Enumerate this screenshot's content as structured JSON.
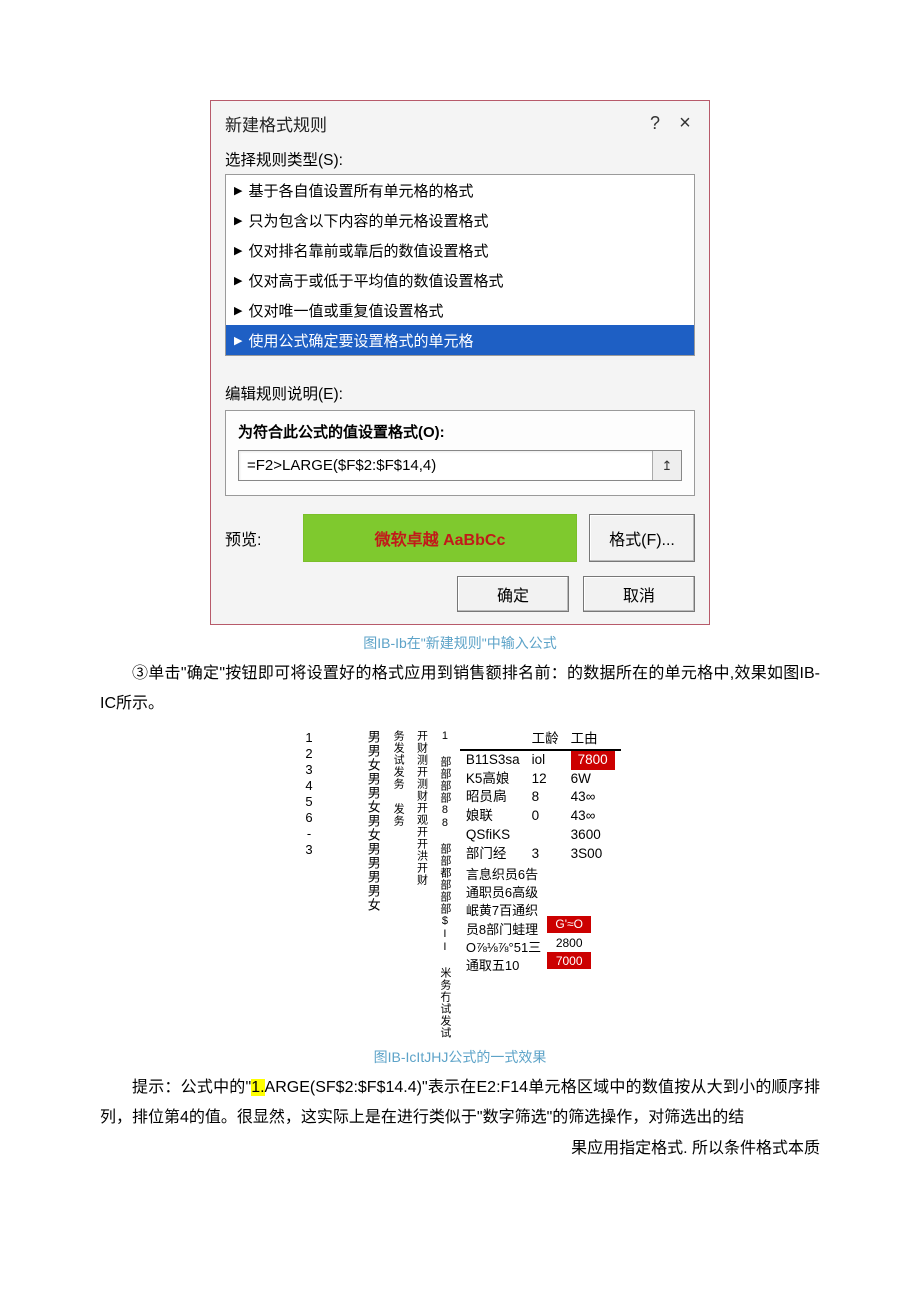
{
  "dialog": {
    "title": "新建格式规则",
    "help": "?",
    "close": "×",
    "section_select": "选择规则类型(S):",
    "rules": [
      "基于各自值设置所有单元格的格式",
      "只为包含以下内容的单元格设置格式",
      "仅对排名靠前或靠后的数值设置格式",
      "仅对高于或低于平均值的数值设置格式",
      "仅对唯一值或重复值设置格式",
      "使用公式确定要设置格式的单元格"
    ],
    "section_edit": "编辑规则说明(E):",
    "formula_label": "为符合此公式的值设置格式(O):",
    "formula_value": "=F2>LARGE($F$2:$F$14,4)",
    "ref_icon": "↥",
    "preview_label": "预览:",
    "preview_text": "微软卓越 AaBbCc",
    "format_button": "格式(F)...",
    "ok": "确定",
    "cancel": "取消"
  },
  "captions": {
    "fig1": "图IB-Ib在\"新建规则\"中输入公式",
    "fig2": "图IB-IcItJHJ公式的一式效果"
  },
  "para1_a": "③单击\"确定\"按钮即可将设置好的格式应用到销售额排名前：的数据所在的单元格中,效果如图",
  "para1_b": "IB-IC",
  "para1_c": "所示。",
  "tip_prefix": "提示：公式中的\"",
  "tip_highlight": "1.",
  "tip_mid": "ARGE(SF$2:$F$14.4)\"表示在E2:F14单元格区域中的数值按从大到小的顺序排列，排位第4的值。很显然，这实际上是在进行类似于\"数字筛选\"的筛选操作，对筛选出的结",
  "tip_tail": "果应用指定格式. 所以条件格式本质",
  "result": {
    "col1": "123456-3",
    "col2": "男男女男男女男女男男男男女",
    "col3a": "务发试发务 发务",
    "col3b": "开财测开测财开观开开洪开财",
    "col4": "1 部部部部88 部部都部部部$II 米务冇试发试",
    "head_work": "工龄",
    "head_salary": "工由",
    "rows": [
      {
        "a": "B11S3sa",
        "b": "iol",
        "c": "7800",
        "red": true
      },
      {
        "a": "K5高娘",
        "b": "12",
        "c": "6W"
      },
      {
        "a": "昭员扄",
        "b": "8",
        "c": "43∞"
      },
      {
        "a": "娘联",
        "b": "0",
        "c": "43∞"
      },
      {
        "a": "QSfiKS",
        "b": "",
        "c": "3600"
      },
      {
        "a": "部门经",
        "b": "3",
        "c": "3S00"
      }
    ],
    "tail_lines": "言息织员6告\n通职员6高级\n岷黄7百通织\n员8部门蛙理\nO⅞⅛⅞°51三\n通取五10",
    "tail_badges": [
      "G'≈O",
      "2800",
      "7000"
    ]
  }
}
